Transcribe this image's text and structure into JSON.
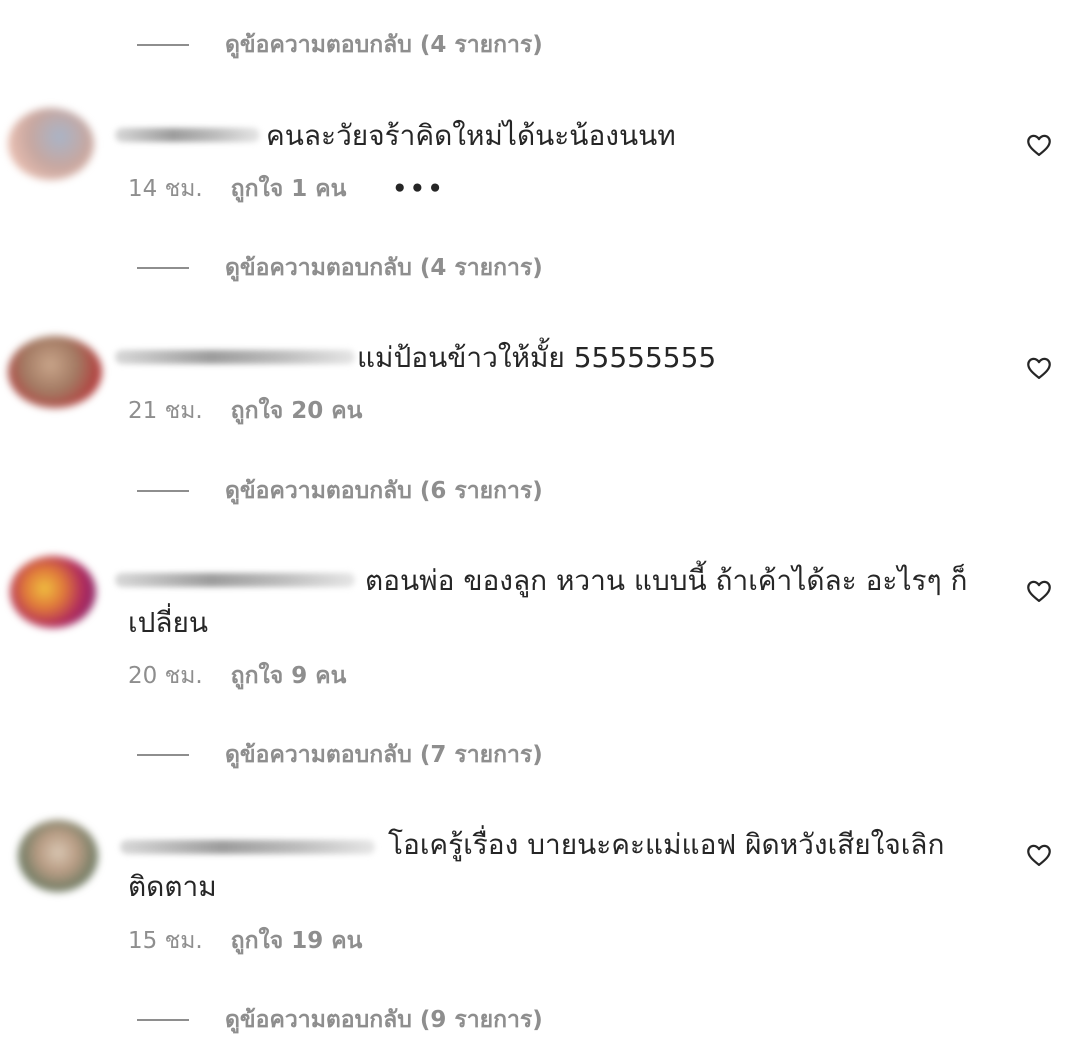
{
  "replies_labels": [
    "ดูข้อความตอบกลับ (4 รายการ)",
    "ดูข้อความตอบกลับ (4 รายการ)",
    "ดูข้อความตอบกลับ (6 รายการ)",
    "ดูข้อความตอบกลับ (7 รายการ)",
    "ดูข้อความตอบกลับ (9 รายการ)"
  ],
  "comments": [
    {
      "text": "คนละวัยจร้าคิดใหม่ได้นะน้องนนท",
      "time": "14 ชม.",
      "likes": "ถูกใจ 1 คน",
      "more": "•••"
    },
    {
      "text": "แม่ป้อนข้าวให้มั้ย 55555555",
      "time": "21 ชม.",
      "likes": "ถูกใจ 20 คน"
    },
    {
      "text_line1": "ตอนพ่อ ของลูก หวาน แบบนี้ ถ้าเค้าได้ละ อะไรๆ ก็",
      "text_line2": "เปลี่ยน",
      "time": "20 ชม.",
      "likes": "ถูกใจ 9 คน"
    },
    {
      "text_line1": "โอเครู้เรื่อง บายนะคะแม่แอฟ ผิดหวังเสียใจเลิก",
      "text_line2": "ติดตาม",
      "time": "15 ชม.",
      "likes": "ถูกใจ 19 คน"
    }
  ],
  "icons": {
    "like": "heart-outline-icon"
  },
  "colors": {
    "text": "#262626",
    "secondary": "#8e8e8e",
    "background": "#ffffff"
  }
}
